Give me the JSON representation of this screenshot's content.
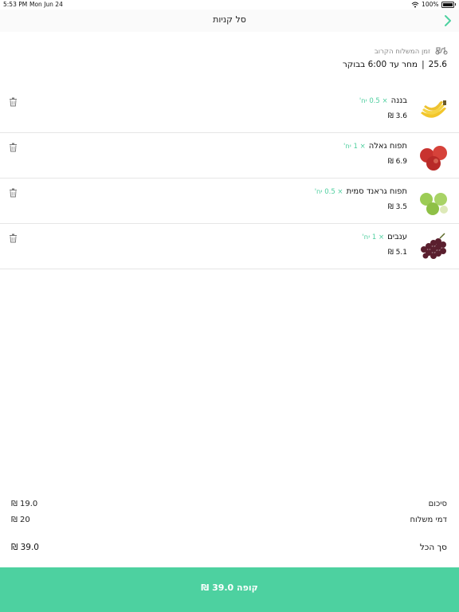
{
  "status": {
    "time": "5:53 PM",
    "date": "Mon Jun 24",
    "battery": "100%"
  },
  "nav": {
    "title": "סל קניות"
  },
  "delivery": {
    "label": "זמן המשלוח הקרוב",
    "date": "25.6",
    "window": "מחר עד 6:00 בבוקר"
  },
  "cart": {
    "items": [
      {
        "name": "בננה",
        "qty": "× 0.5 יח'",
        "price": "3.6 ₪"
      },
      {
        "name": "תפוח גאלה",
        "qty": "× 1 יח'",
        "price": "6.9 ₪"
      },
      {
        "name": "תפוח גראנד סמית",
        "qty": "× 0.5 יח'",
        "price": "3.5 ₪"
      },
      {
        "name": "ענבים",
        "qty": "× 1 יח'",
        "price": "5.1 ₪"
      }
    ]
  },
  "summary": {
    "subtotal_label": "סיכום",
    "subtotal_value": "19.0 ₪",
    "delivery_label": "דמי משלוח",
    "delivery_value": "20 ₪",
    "total_label": "סך הכל",
    "total_value": "39.0 ₪"
  },
  "checkout": {
    "label": "קופה 39.0 ₪"
  },
  "colors": {
    "accent": "#4dd1a0",
    "qty_text": "#4fcf9f"
  }
}
